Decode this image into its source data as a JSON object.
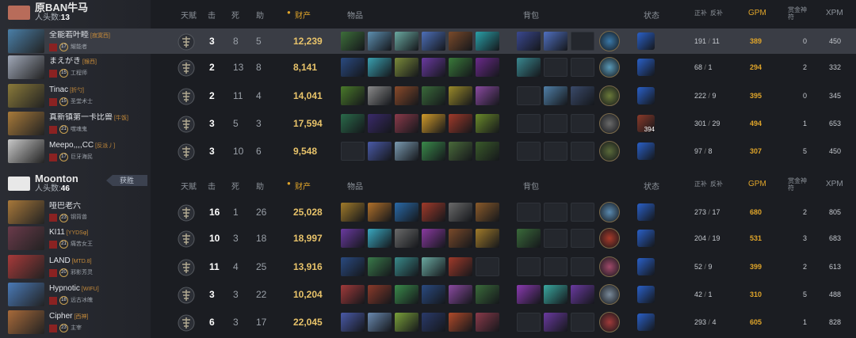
{
  "colors": {
    "gold": "#e0a52a",
    "row_selected": "#3a3d45",
    "bg": "#1b1d22"
  },
  "headers": {
    "talent": "天赋",
    "kills": "击",
    "deaths": "死",
    "assists": "助",
    "networth": "财产",
    "items": "物品",
    "backpack": "背包",
    "status": "状态",
    "lasthits": "正补",
    "lasthits_sep": "反补",
    "gpm": "GPM",
    "bounty": "赏金神符",
    "xpm": "XPM"
  },
  "teams": [
    {
      "name": "原BAN牛马",
      "kills_label": "人头数:",
      "kills": "13",
      "logo_color": "#b86c5a",
      "won_label": "",
      "players": [
        {
          "name": "全能若叶睦",
          "tag": "[寂寞西]",
          "level": "17",
          "role": "耀能者",
          "hero_color": "#4a7fa8",
          "hero_icon": "hero-portrait-icon",
          "kills": "3",
          "deaths": "8",
          "assists": "5",
          "networth": "12,239",
          "lh": "191",
          "dn": "11",
          "gpm": "389",
          "bounty": "0",
          "xpm": "450",
          "selected": true,
          "items": [
            "#3d6e3a",
            "#5d8fb0",
            "#6aa8a0",
            "#4d6fb8",
            "#7a4a2a",
            "#2aa0a8"
          ],
          "backpack": [
            "#3a4890",
            "#5070c0",
            "empty"
          ],
          "neutral": "#3a78a8",
          "buff": "#2a60c8",
          "buff_num": ""
        },
        {
          "name": "まえがき",
          "tag": "[猴西]",
          "level": "15",
          "role": "工程师",
          "hero_color": "#a0a8b8",
          "hero_icon": "hero-portrait-icon",
          "kills": "2",
          "deaths": "13",
          "assists": "8",
          "networth": "8,141",
          "lh": "68",
          "dn": "1",
          "gpm": "294",
          "bounty": "2",
          "xpm": "332",
          "selected": false,
          "items": [
            "#2a4a80",
            "#3aa0b0",
            "#7a8a3a",
            "#6a3aa0",
            "#3a7a3a",
            "#6a2a8a"
          ],
          "backpack": [
            "#3a8890",
            "empty",
            "empty"
          ],
          "neutral": "#5a9ab8",
          "buff": "#2a60c8",
          "buff_num": ""
        },
        {
          "name": "Tinac",
          "tag": "[折勺]",
          "level": "15",
          "role": "圣堂术士",
          "hero_color": "#8a7a3a",
          "hero_icon": "hero-portrait-icon",
          "kills": "2",
          "deaths": "11",
          "assists": "4",
          "networth": "14,041",
          "lh": "222",
          "dn": "9",
          "gpm": "395",
          "bounty": "0",
          "xpm": "345",
          "selected": false,
          "items": [
            "#4a7a2a",
            "#8a8a8a",
            "#8a4a2a",
            "#3a6a3a",
            "#9a8a2a",
            "#8a4aa0"
          ],
          "backpack": [
            "empty",
            "#5080a8",
            "#3a4a6a"
          ],
          "neutral": "#6a7a3a",
          "buff": "#2a60c8",
          "buff_num": ""
        },
        {
          "name": "真新镇第一卡比兽",
          "tag": "[牛饭]",
          "level": "21",
          "role": "噬魂鬼",
          "hero_color": "#a87a3a",
          "hero_icon": "hero-portrait-icon",
          "kills": "3",
          "deaths": "5",
          "assists": "3",
          "networth": "17,594",
          "lh": "301",
          "dn": "29",
          "gpm": "494",
          "bounty": "1",
          "xpm": "653",
          "selected": false,
          "items": [
            "#2a6a4a",
            "#3a2a6a",
            "#8a3a4a",
            "#d09a2a",
            "#a03a2a",
            "#6a8a2a"
          ],
          "backpack": [
            "empty",
            "empty",
            "empty"
          ],
          "neutral": "#6a6a6a",
          "buff": "#8a3a2a",
          "buff_num": "394"
        },
        {
          "name": "Meepo,,,,CC",
          "tag": "[反派丿]",
          "level": "17",
          "role": "巨牙海民",
          "hero_color": "#c8c8c8",
          "hero_icon": "hero-portrait-icon",
          "kills": "3",
          "deaths": "10",
          "assists": "6",
          "networth": "9,548",
          "lh": "97",
          "dn": "8",
          "gpm": "307",
          "bounty": "5",
          "xpm": "450",
          "selected": false,
          "items": [
            "empty",
            "#4a5aa8",
            "#7a9ab0",
            "#3a8a4a",
            "#4a6a3a",
            "#3a5a2a"
          ],
          "backpack": [
            "empty",
            "empty",
            "empty"
          ],
          "neutral": "#5a6a3a",
          "buff": "#2a60c8",
          "buff_num": ""
        }
      ]
    },
    {
      "name": "Moonton",
      "kills_label": "人头数:",
      "kills": "46",
      "logo_color": "#e8e8e8",
      "won_label": "获胜",
      "players": [
        {
          "name": "哑巴老六",
          "tag": "",
          "level": "23",
          "role": "钢背兽",
          "hero_color": "#a8783a",
          "hero_icon": "hero-portrait-icon",
          "kills": "16",
          "deaths": "1",
          "assists": "26",
          "networth": "25,028",
          "lh": "273",
          "dn": "17",
          "gpm": "680",
          "bounty": "2",
          "xpm": "805",
          "selected": false,
          "items": [
            "#a07a2a",
            "#b0702a",
            "#2a6aa8",
            "#a03a2a",
            "#6a6a6a",
            "#8a5a2a"
          ],
          "backpack": [
            "empty",
            "empty",
            "empty"
          ],
          "neutral": "#5a8ab0",
          "buff": "#2a60c8",
          "buff_num": ""
        },
        {
          "name": "KI11",
          "tag": "[YYDSφ]",
          "level": "21",
          "role": "痛苦女王",
          "hero_color": "#6a3a4a",
          "hero_icon": "hero-portrait-icon",
          "kills": "10",
          "deaths": "3",
          "assists": "18",
          "networth": "18,997",
          "lh": "204",
          "dn": "19",
          "gpm": "531",
          "bounty": "3",
          "xpm": "683",
          "selected": false,
          "items": [
            "#6a3aa0",
            "#3aa8c0",
            "#6a6a6a",
            "#8a3aa0",
            "#7a4a2a",
            "#a07a2a"
          ],
          "backpack": [
            "#3a6a3a",
            "empty",
            "empty"
          ],
          "neutral": "#a83a2a",
          "buff": "#2a60c8",
          "buff_num": ""
        },
        {
          "name": "LAND",
          "tag": "[MTD.8]",
          "level": "20",
          "role": "邪影芳灵",
          "hero_color": "#a83a3a",
          "hero_icon": "hero-portrait-icon",
          "kills": "11",
          "deaths": "4",
          "assists": "25",
          "networth": "13,916",
          "lh": "52",
          "dn": "9",
          "gpm": "399",
          "bounty": "2",
          "xpm": "613",
          "selected": false,
          "items": [
            "#2a4a80",
            "#3a7a4a",
            "#3a8a8a",
            "#6aa8a0",
            "#a03a2a",
            "empty"
          ],
          "backpack": [
            "empty",
            "empty",
            "empty"
          ],
          "neutral": "#a04a6a",
          "buff": "#2a60c8",
          "buff_num": ""
        },
        {
          "name": "Hypnotic",
          "tag": "[WIFU]",
          "level": "18",
          "role": "远古冰魄",
          "hero_color": "#4a7ab8",
          "hero_icon": "hero-portrait-icon",
          "kills": "3",
          "deaths": "3",
          "assists": "22",
          "networth": "10,204",
          "lh": "42",
          "dn": "1",
          "gpm": "310",
          "bounty": "5",
          "xpm": "488",
          "selected": false,
          "items": [
            "#a03a3a",
            "#8a3a2a",
            "#3a8a4a",
            "#2a4a80",
            "#8a4aa0",
            "#3a6a3a"
          ],
          "backpack": [
            "#8a3ab0",
            "#3aa8a0",
            "#6a3aa0"
          ],
          "neutral": "#7a8a9a",
          "buff": "#2a60c8",
          "buff_num": ""
        },
        {
          "name": "Cipher",
          "tag": "[西神]",
          "level": "23",
          "role": "主宰",
          "hero_color": "#a86a3a",
          "hero_icon": "hero-portrait-icon",
          "kills": "6",
          "deaths": "3",
          "assists": "17",
          "networth": "22,045",
          "lh": "293",
          "dn": "4",
          "gpm": "605",
          "bounty": "1",
          "xpm": "828",
          "selected": false,
          "items": [
            "#4a5aa8",
            "#6a8ab0",
            "#7aa03a",
            "#2a3a6a",
            "#b04a2a",
            "#8a3a4a"
          ],
          "backpack": [
            "empty",
            "#6a3aa0",
            "empty"
          ],
          "neutral": "#a03a3a",
          "buff": "#2a60c8",
          "buff_num": ""
        }
      ]
    }
  ]
}
